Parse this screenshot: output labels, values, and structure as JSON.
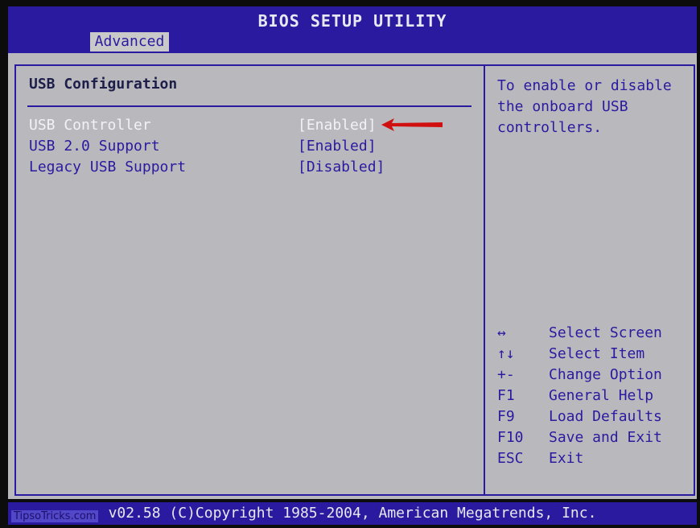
{
  "header": {
    "title": "BIOS SETUP UTILITY",
    "tab": "Advanced"
  },
  "main": {
    "section_title": "USB Configuration",
    "items": [
      {
        "label": "USB Controller",
        "value": "[Enabled]",
        "selected": true
      },
      {
        "label": "USB 2.0 Support",
        "value": "[Enabled]",
        "selected": false
      },
      {
        "label": "Legacy USB Support",
        "value": "[Disabled]",
        "selected": false
      }
    ]
  },
  "help": {
    "description": "To enable or disable the onboard USB controllers.",
    "keys": [
      {
        "key": "↔",
        "action": "Select Screen"
      },
      {
        "key": "↑↓",
        "action": "Select Item"
      },
      {
        "key": "+-",
        "action": "Change Option"
      },
      {
        "key": "F1",
        "action": "General Help"
      },
      {
        "key": "F9",
        "action": "Load Defaults"
      },
      {
        "key": "F10",
        "action": "Save and Exit"
      },
      {
        "key": "ESC",
        "action": "Exit"
      }
    ]
  },
  "footer": {
    "text": "v02.58 (C)Copyright 1985-2004, American Megatrends, Inc.",
    "watermark": "TipsoTricks.com"
  },
  "colors": {
    "bios_blue": "#2a1aa0",
    "panel_gray": "#b9b9bd",
    "highlight_text": "#f2f2f6",
    "annotation_arrow": "#d01010"
  }
}
